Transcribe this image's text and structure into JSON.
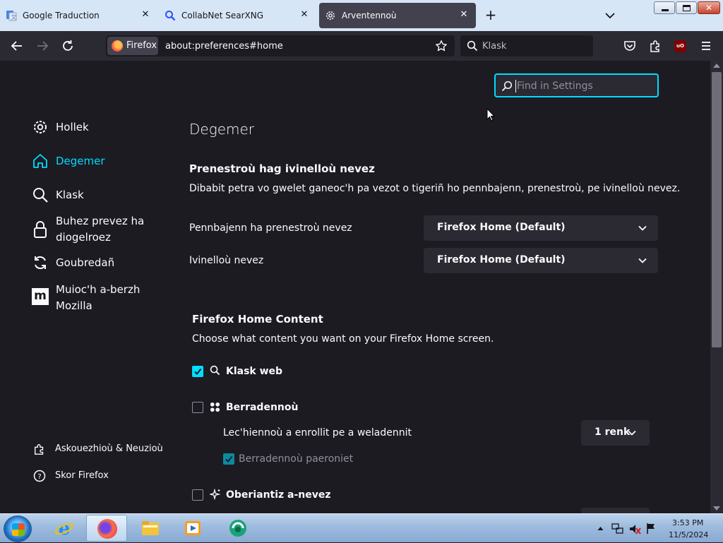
{
  "tabs": [
    {
      "label": "Google Traduction",
      "icon": "google-translate-icon"
    },
    {
      "label": "CollabNet SearXNG",
      "icon": "search-icon"
    },
    {
      "label": "Arventennoù",
      "icon": "gear-icon",
      "active": true
    }
  ],
  "toolbar": {
    "identity_label": "Firefox",
    "url": "about:preferences#home",
    "search_placeholder": "Klask"
  },
  "settings": {
    "find_placeholder": "Find in Settings",
    "categories": [
      {
        "label": "Hollek",
        "icon": "gear-icon"
      },
      {
        "label": "Degemer",
        "icon": "home-icon",
        "selected": true
      },
      {
        "label": "Klask",
        "icon": "search-icon"
      },
      {
        "label": "Buhez prevez ha diogelroez",
        "icon": "lock-icon"
      },
      {
        "label": "Goubredañ",
        "icon": "sync-icon"
      },
      {
        "label": "Muioc'h a-berzh Mozilla",
        "icon": "mozilla-icon"
      }
    ],
    "footer": [
      {
        "label": "Askouezhioù & Neuzioù",
        "icon": "puzzle-icon"
      },
      {
        "label": "Skor Firefox",
        "icon": "help-icon"
      }
    ],
    "page_title": "Degemer",
    "new_windows": {
      "heading": "Prenestroù hag ivinelloù nevez",
      "description": "Dibabit petra vo gwelet ganeoc'h pa vezot o tigeriñ ho pennbajenn, prenestroù, pe ivinelloù nevez.",
      "homepage_label": "Pennbajenn ha prenestroù nevez",
      "homepage_value": "Firefox Home (Default)",
      "newtabs_label": "Ivinelloù nevez",
      "newtabs_value": "Firefox Home (Default)"
    },
    "home_content": {
      "heading": "Firefox Home Content",
      "description": "Choose what content you want on your Firefox Home screen.",
      "web_search": {
        "label": "Klask web",
        "checked": true
      },
      "shortcuts": {
        "label": "Berradennoù",
        "checked": false
      },
      "shortcuts_rows_label": "Lec'hiennoù a enrollit pe a weladennit",
      "shortcuts_rows_value": "1 renk",
      "sponsored_shortcuts": {
        "label": "Berradennoù paeroniet",
        "checked": true
      },
      "recommended": {
        "label": "Oberiantiz a-nevez",
        "checked": false
      }
    }
  },
  "taskbar": {
    "time": "3:53 PM",
    "date": "11/5/2024",
    "apps": [
      "internet-explorer-icon",
      "firefox-icon",
      "explorer-folder-icon",
      "media-player-icon",
      "app-icon"
    ]
  },
  "colors": {
    "accent": "#00ddff",
    "background": "#1c1b22",
    "panel": "#2b2a33"
  }
}
